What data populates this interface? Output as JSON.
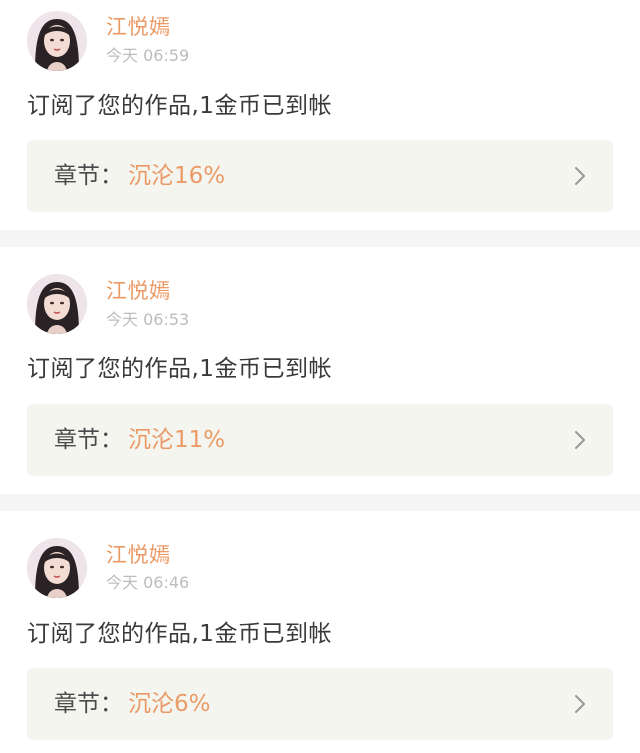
{
  "notifications": [
    {
      "avatar": "avatar-image",
      "user": "江悦嫣",
      "time": "今天 06:59",
      "message": "订阅了您的作品,1金币已到帐",
      "chapter_label": "章节：",
      "chapter_title": "沉沦16%",
      "chevron": "chevron-right-icon"
    },
    {
      "avatar": "avatar-image",
      "user": "江悦嫣",
      "time": "今天 06:53",
      "message": "订阅了您的作品,1金币已到帐",
      "chapter_label": "章节：",
      "chapter_title": "沉沦11%",
      "chevron": "chevron-right-icon"
    },
    {
      "avatar": "avatar-image",
      "user": "江悦嫣",
      "time": "今天 06:46",
      "message": "订阅了您的作品,1金币已到帐",
      "chapter_label": "章节：",
      "chapter_title": "沉沦6%",
      "chevron": "chevron-right-icon"
    }
  ],
  "colors": {
    "accent": "#eb9a66",
    "chapter_bg": "#f5f5f0",
    "separator": "#f5f5f5",
    "muted_text": "#bdbdbd"
  }
}
